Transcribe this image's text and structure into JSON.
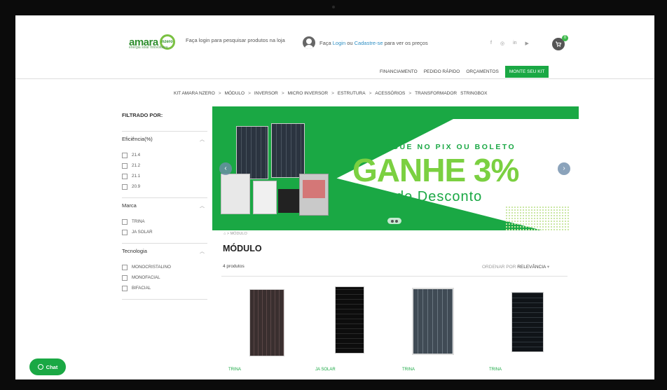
{
  "header": {
    "logo_text": "amara",
    "logo_circle_text": "nzero",
    "logo_subtitle": "energia solar fotovoltaica",
    "search_hint": "Faça login para pesquisar produtos na loja",
    "login_prefix": "Faça ",
    "login_link": "Login",
    "login_or": " ou ",
    "register_link": "Cadastre-se",
    "login_suffix": " para ver os preços",
    "socials": [
      "f",
      "◎",
      "in",
      "▶"
    ],
    "cart_badge": "0",
    "cart_icon": "cart-icon"
  },
  "topnav": {
    "items": [
      "FINANCIAMENTO",
      "PEDIDO RÁPIDO",
      "ORÇAMENTOS"
    ],
    "cta": "MONTE SEU KIT"
  },
  "catnav": {
    "items": [
      "KIT AMARA NZERO",
      "MÓDULO",
      "INVERSOR",
      "MICRO INVERSOR",
      "ESTRUTURA",
      "ACESSÓRIOS",
      "TRANSFORMADOR",
      "STRINGBOX"
    ],
    "separator": ">"
  },
  "sidebar": {
    "title": "FILTRADO POR:",
    "groups": [
      {
        "label": "Eficiência(%)",
        "options": [
          "21.4",
          "21.2",
          "21.1",
          "20.9"
        ]
      },
      {
        "label": "Marca",
        "options": [
          "TRINA",
          "JA SOLAR"
        ]
      },
      {
        "label": "Tecnologia",
        "options": [
          "MONOCRISTALINO",
          "MONOFACIAL",
          "BIFACIAL"
        ]
      }
    ]
  },
  "banner": {
    "line1": "PAGUE NO PIX OU BOLETO",
    "line2": "GANHE 3%",
    "line3": "de Desconto",
    "prev_arrow": "‹",
    "next_arrow": "›"
  },
  "main": {
    "breadcrumb": "⌂ > MÓDULO",
    "title": "MÓDULO",
    "count": "4 produtos",
    "sort_label": "ORDENAR POR ",
    "sort_value": "RELEVÂNCIA",
    "sort_caret": "▾",
    "products": [
      {
        "brand": "TRINA"
      },
      {
        "brand": "JA SOLAR"
      },
      {
        "brand": "TRINA"
      },
      {
        "brand": "TRINA"
      }
    ]
  },
  "chat": {
    "label": "Chat"
  },
  "colors": {
    "brand_green": "#1aa844",
    "light_green": "#7bd041",
    "link_blue": "#2f8fc4"
  }
}
